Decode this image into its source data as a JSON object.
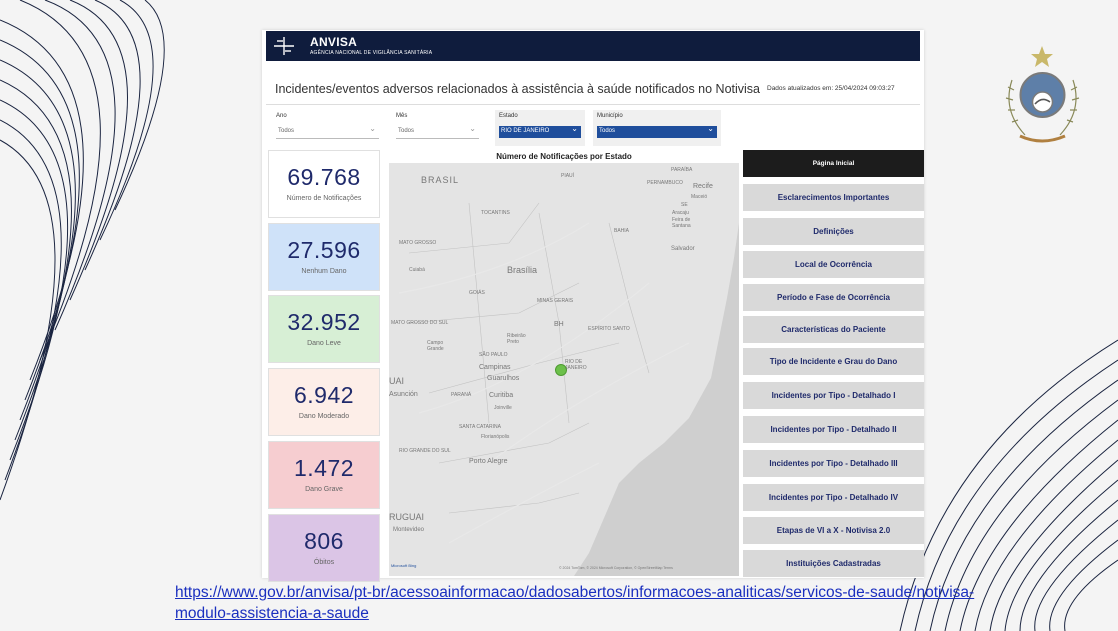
{
  "banner": {
    "title": "ANVISA",
    "subtitle": "AGÊNCIA NACIONAL DE VIGILÂNCIA SANITÁRIA"
  },
  "headline": "Incidentes/eventos adversos relacionados à assistência à saúde notificados no Notivisa",
  "updated": "Dados atualizados em: 25/04/2024 09:03:27",
  "filters": [
    {
      "label": "Ano",
      "value": "Todos"
    },
    {
      "label": "Mês",
      "value": "Todos"
    },
    {
      "label": "Estado",
      "value": "RIO DE JANEIRO"
    },
    {
      "label": "Município",
      "value": "Todos"
    }
  ],
  "kpis": [
    {
      "value": "69.768",
      "label": "Número de Notificações",
      "color": "#ffffff"
    },
    {
      "value": "27.596",
      "label": "Nenhum Dano",
      "color": "#cfe2f9"
    },
    {
      "value": "32.952",
      "label": "Dano Leve",
      "color": "#d7efd5"
    },
    {
      "value": "6.942",
      "label": "Dano Moderado",
      "color": "#fdeee8"
    },
    {
      "value": "1.472",
      "label": "Dano Grave",
      "color": "#f6cdd0"
    },
    {
      "value": "806",
      "label": "Óbitos",
      "color": "#dbc5e6"
    }
  ],
  "map": {
    "title": "Número de Notificações por Estado",
    "labels": [
      "BRASIL",
      "PIAUÍ",
      "PARAÍBA",
      "PERNAMBUCO",
      "Recife",
      "Maceió",
      "TOCANTINS",
      "SE",
      "Aracaju",
      "Feira de Santana",
      "BAHIA",
      "Salvador",
      "MATO GROSSO",
      "Cuiabá",
      "Brasília",
      "GOIÁS",
      "MINAS GERAIS",
      "MATO GROSSO DO SUL",
      "BH",
      "ESPÍRITO SANTO",
      "Ribeirão Preto",
      "Campo Grande",
      "SÃO PAULO",
      "Campinas",
      "RIO DE JANEIRO",
      "Guarulhos",
      "UAI",
      "Asunción",
      "PARANÁ",
      "Curitiba",
      "Joinville",
      "SANTA CATARINA",
      "Florianópolis",
      "RIO GRANDE DO SUL",
      "Porto Alegre",
      "RUGUAI",
      "Montevideo"
    ],
    "attribution": "© 2024 TomTom, © 2024 Microsoft Corporation, © OpenStreetMap  Terms",
    "bing": "Microsoft Bing"
  },
  "nav": [
    "Página Inicial",
    "Esclarecimentos Importantes",
    "Definições",
    "Local de Ocorrência",
    "Período e Fase de Ocorrência",
    "Características do Paciente",
    "Tipo de Incidente e Grau do Dano",
    "Incidentes por Tipo - Detalhado I",
    "Incidentes por Tipo - Detalhado II",
    "Incidentes por Tipo - Detalhado III",
    "Incidentes por Tipo - Detalhado IV",
    "Etapas de VI a X - Notivisa 2.0",
    "Instituições Cadastradas"
  ],
  "link": "https://www.gov.br/anvisa/pt-br/acessoainformacao/dadosabertos/informacoes-analiticas/servicos-de-saude/notivisa-modulo-assistencia-a-saude",
  "colors": {
    "banner": "#0f1c3d",
    "accent": "#1f4e9c",
    "kpi_text": "#1f2a6b",
    "marker": "#6cc04a"
  }
}
